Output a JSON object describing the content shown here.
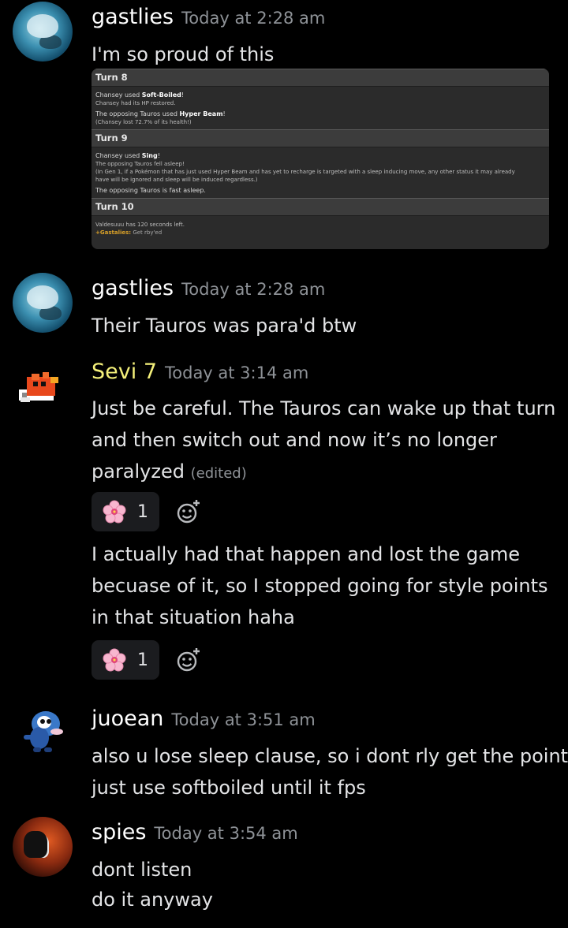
{
  "messages": [
    {
      "username": "gastlies",
      "timestamp": "Today at 2:28 am",
      "text": "I'm so proud of this",
      "attachment": {
        "turns": [
          {
            "label": "Turn 8",
            "lines": [
              {
                "pre": "Chansey used ",
                "bold": "Soft-Boiled",
                "post": "!"
              },
              {
                "text": "Chansey had its HP restored."
              },
              {
                "pre": "The opposing Tauros used ",
                "bold": "Hyper Beam",
                "post": "!"
              },
              {
                "text": "(Chansey lost 72.7% of its health!)"
              }
            ]
          },
          {
            "label": "Turn 9",
            "lines": [
              {
                "pre": "Chansey used ",
                "bold": "Sing",
                "post": "!"
              },
              {
                "text": "The opposing Tauros fell asleep!"
              },
              {
                "text": "(In Gen 1, if a Pokémon that has just used Hyper Beam and has yet to recharge is targeted with a sleep inducing move, any other status it may already"
              },
              {
                "text": "have will be ignored and sleep will be induced regardless.)"
              },
              {
                "text": "The opposing Tauros is fast asleep."
              }
            ]
          },
          {
            "label": "Turn 10",
            "lines": [
              {
                "text": "Valdesuuu has 120 seconds left."
              },
              {
                "chat_user": "+Gastalies:",
                "chat_text": " Get rby'ed"
              }
            ]
          }
        ]
      }
    },
    {
      "username": "gastlies",
      "timestamp": "Today at 2:28 am",
      "text": "Their Tauros was para'd btw"
    },
    {
      "username": "Sevi 7",
      "timestamp": "Today at 3:14 am",
      "lines": [
        "Just be careful. The Tauros can wake up that turn",
        "and then switch out and now it’s no longer",
        "paralyzed"
      ],
      "edited": "(edited)",
      "reaction_count": "1",
      "lines2": [
        "I actually had that happen and lost the game",
        "becuase of it, so I stopped going for style points",
        "in that situation haha"
      ],
      "reaction_count2": "1"
    },
    {
      "username": "juoean",
      "timestamp": "Today at 3:51 am",
      "lines": [
        "also u lose sleep clause, so i dont rly get the point",
        "just use softboiled until it fps"
      ]
    },
    {
      "username": "spies",
      "timestamp": "Today at 3:54 am",
      "lines": [
        "dont listen",
        "do it anyway"
      ]
    }
  ],
  "reaction_emoji": "cherry-blossom-icon",
  "colors": {
    "background": "#000000",
    "username": "#ffffff",
    "sevi_username": "#f4f07a",
    "timestamp": "#8e9297",
    "message_text": "#e3e4e6",
    "reaction_bg": "#1b1c1f"
  }
}
